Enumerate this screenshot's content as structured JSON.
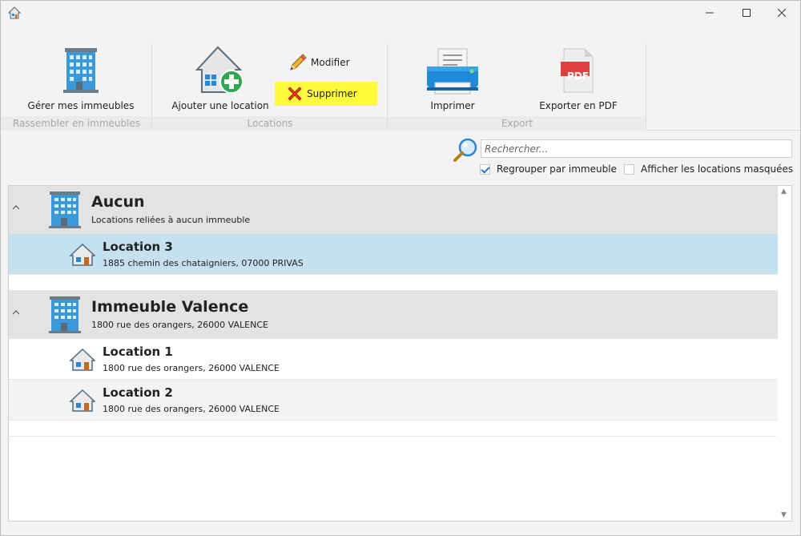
{
  "window": {
    "title": ""
  },
  "ribbon": {
    "groups": [
      {
        "label": "Rassembler en immeubles",
        "buttons": {
          "manage": "Gérer mes immeubles"
        }
      },
      {
        "label": "Locations",
        "buttons": {
          "add": "Ajouter une location",
          "edit": "Modifier",
          "delete": "Supprimer"
        }
      },
      {
        "label": "Export",
        "buttons": {
          "print": "Imprimer",
          "pdf": "Exporter en PDF"
        }
      }
    ],
    "pdf_badge": "PDF"
  },
  "search": {
    "placeholder": "Rechercher...",
    "value": ""
  },
  "options": {
    "group_by_building": {
      "label": "Regrouper par immeuble",
      "checked": true
    },
    "show_hidden": {
      "label": "Afficher les locations masquées",
      "checked": false
    }
  },
  "list": {
    "groups": [
      {
        "title": "Aucun",
        "subtitle": "Locations reliées à aucun immeuble",
        "items": [
          {
            "title": "Location 3",
            "address": "1885 chemin des chataigniers, 07000 PRIVAS",
            "selected": true
          }
        ]
      },
      {
        "title": "Immeuble Valence",
        "subtitle": "1800 rue des orangers, 26000 VALENCE",
        "items": [
          {
            "title": "Location 1",
            "address": "1800 rue des orangers, 26000 VALENCE",
            "selected": false
          },
          {
            "title": "Location 2",
            "address": "1800 rue des orangers, 26000 VALENCE",
            "selected": false
          }
        ]
      }
    ]
  },
  "colors": {
    "highlight": "#fffa3c",
    "selected_row": "#c5e0ee",
    "group_row": "#e3e3e3",
    "building_blue": "#3a9ad9"
  }
}
